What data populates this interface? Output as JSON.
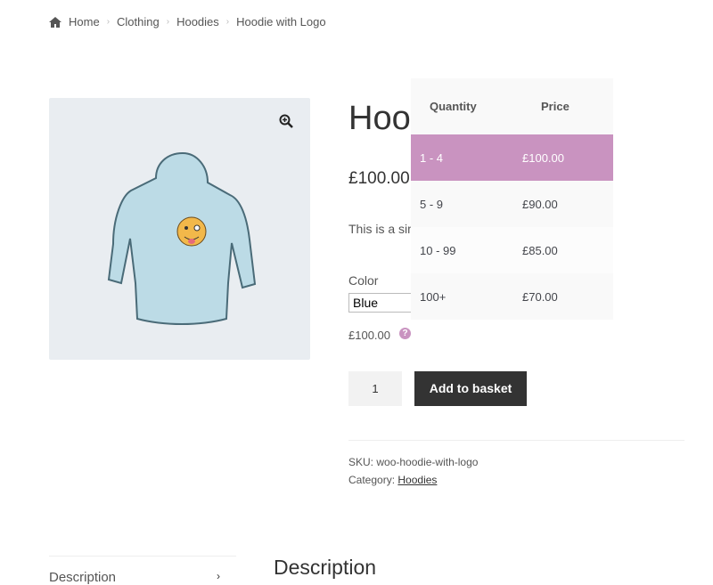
{
  "breadcrumb": {
    "items": [
      "Home",
      "Clothing",
      "Hoodies",
      "Hoodie with Logo"
    ]
  },
  "product": {
    "title": "Hoodie with Logo",
    "price": "£100.00",
    "short_description": "This is a simple product.",
    "color_label": "Color",
    "color_value": "Blue",
    "variation_price": "£100.00",
    "quantity": "1",
    "add_to_basket": "Add to basket",
    "sku_label": "SKU:",
    "sku": "woo-hoodie-with-logo",
    "category_label": "Category:",
    "category": "Hoodies"
  },
  "tiers": {
    "headers": [
      "Quantity",
      "Price"
    ],
    "rows": [
      {
        "qty": "1 - 4",
        "price": "£100.00"
      },
      {
        "qty": "5 - 9",
        "price": "£90.00"
      },
      {
        "qty": "10 - 99",
        "price": "£85.00"
      },
      {
        "qty": "100+",
        "price": "£70.00"
      }
    ],
    "active_color": "#c993c0"
  },
  "tabs": {
    "items": [
      "Description"
    ],
    "heading": "Description"
  }
}
